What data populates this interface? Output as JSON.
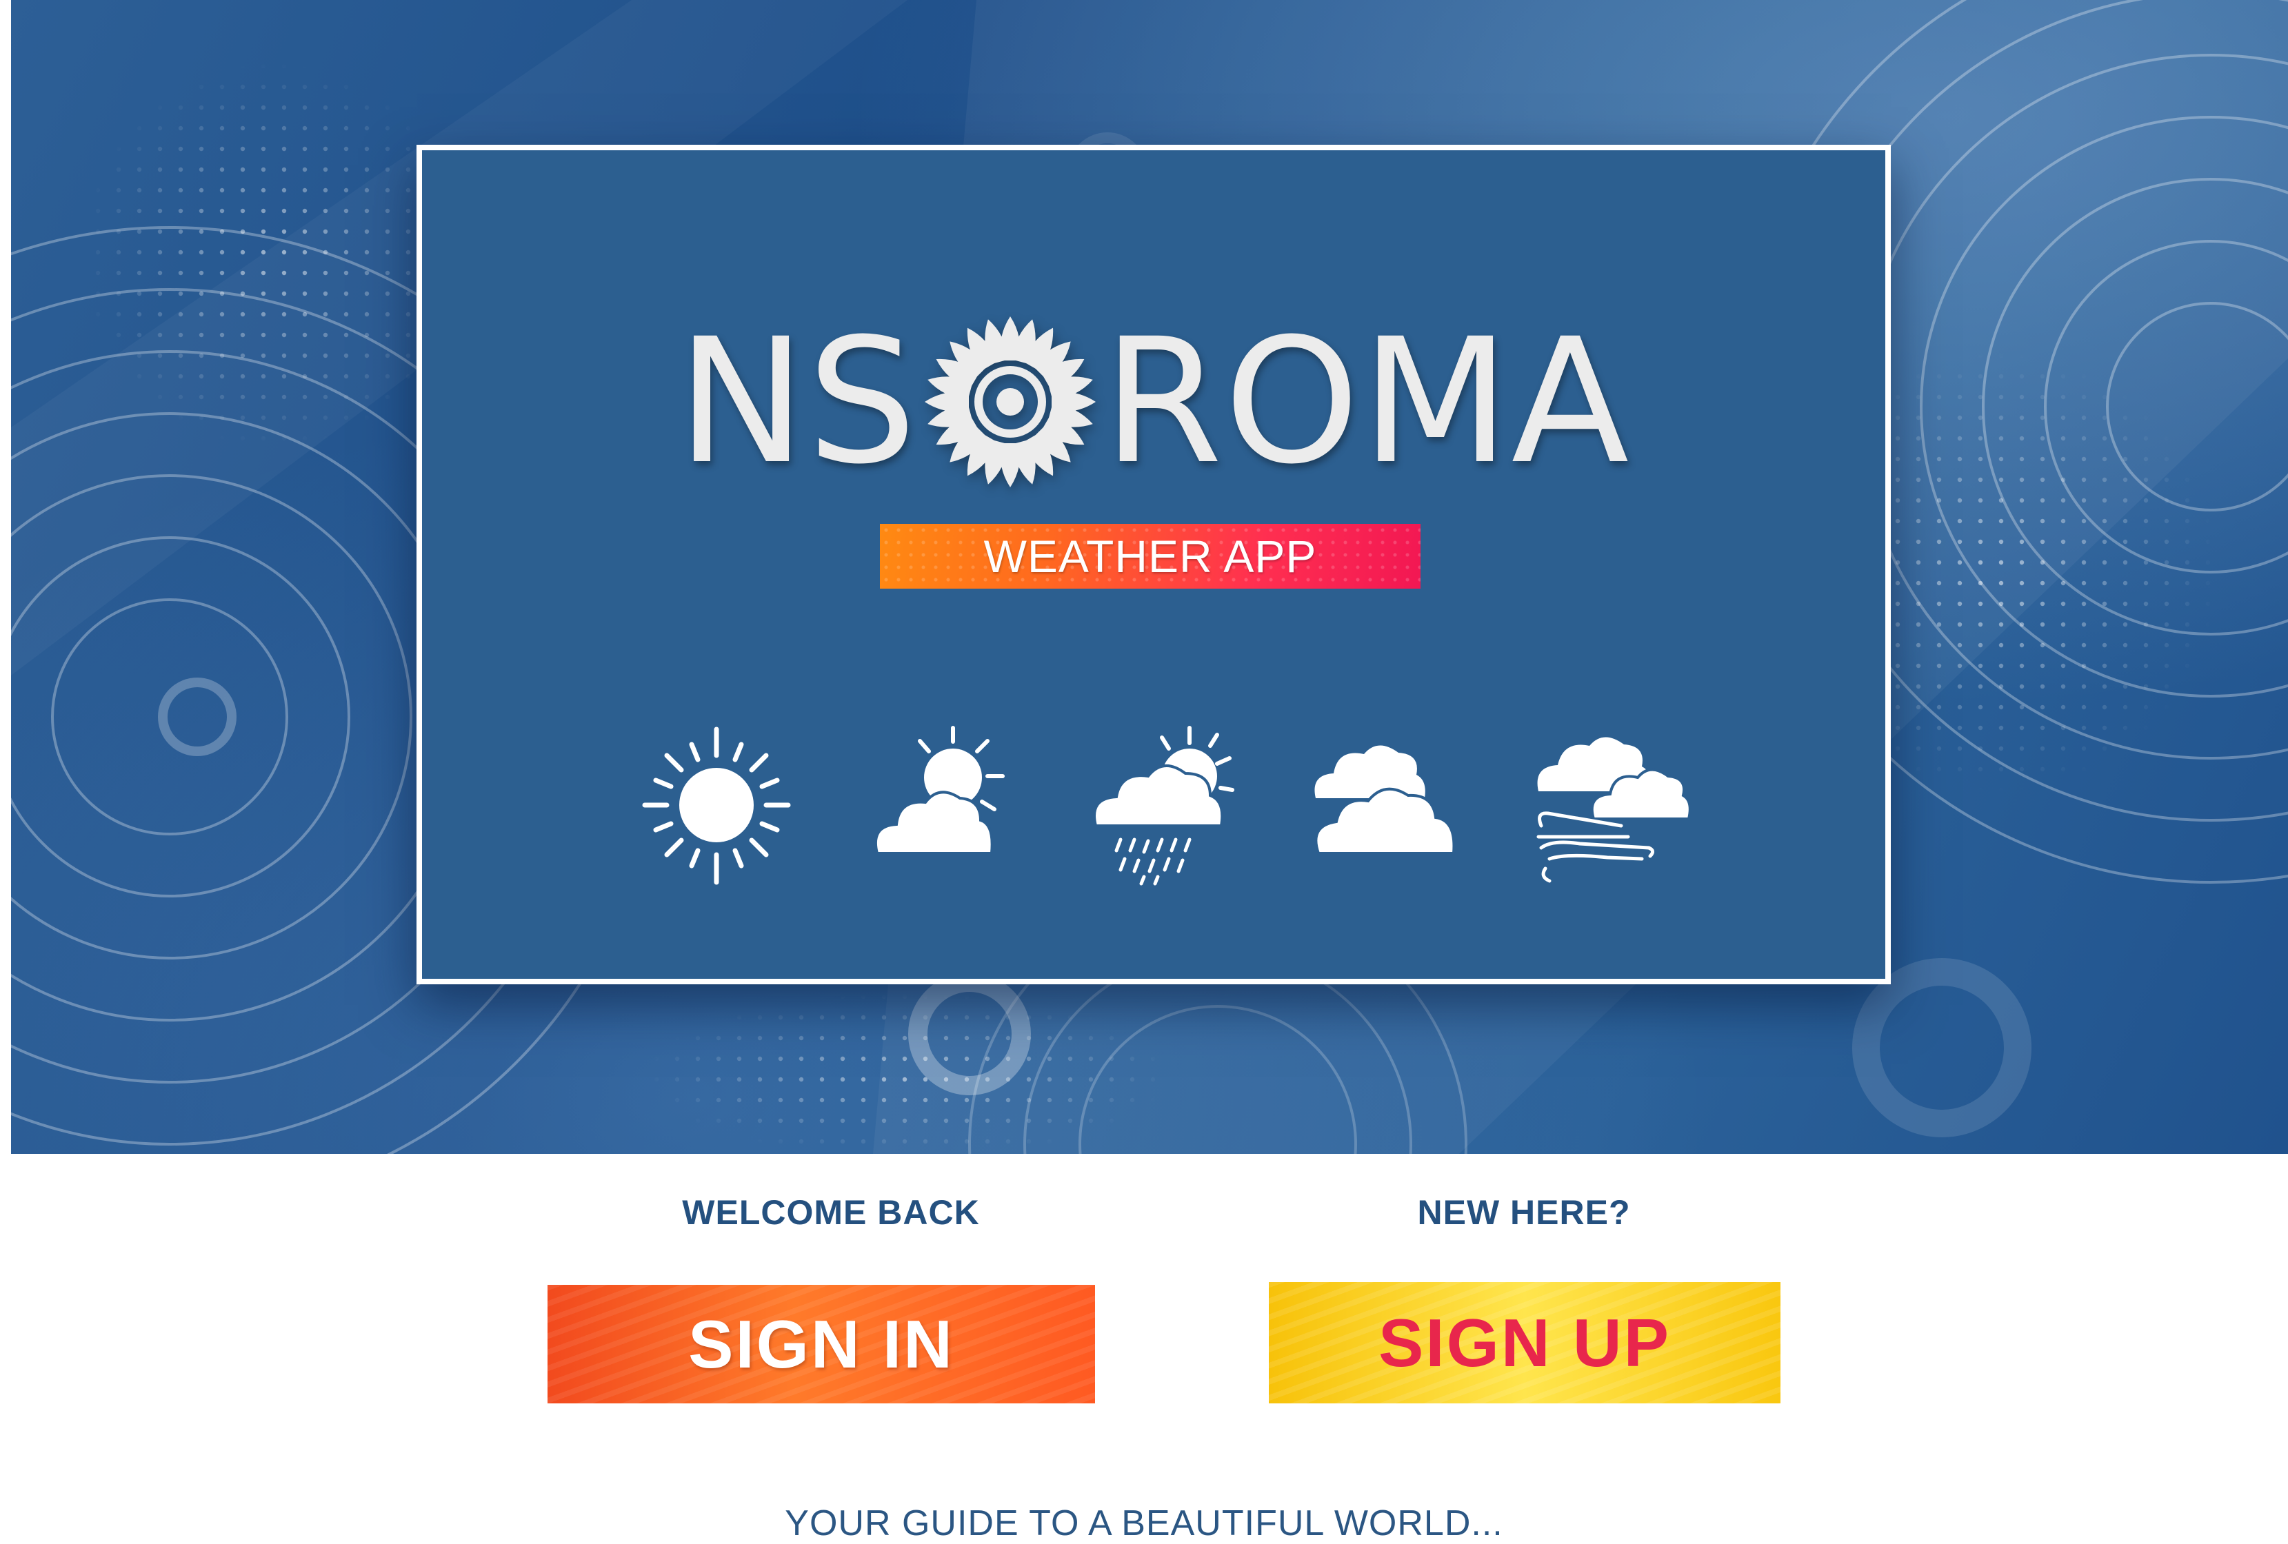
{
  "app": {
    "logo_left": "NS",
    "logo_right": "ROMA",
    "subtitle": "WEATHER APP"
  },
  "weather_icons": [
    "sun-icon",
    "partly-sunny-icon",
    "sun-rain-icon",
    "cloudy-icon",
    "windy-icon"
  ],
  "auth": {
    "welcome_label": "WELCOME BACK",
    "signin_label": "SIGN IN",
    "new_label": "NEW HERE?",
    "signup_label": "SIGN UP"
  },
  "tagline": "YOUR GUIDE TO A BEAUTIFUL WORLD...",
  "colors": {
    "hero_blue": "#2c5f90",
    "banner_orange": "#ff7a1a",
    "banner_pink": "#f21753",
    "signin_orange": "#ff5a22",
    "signup_yellow": "#ffd21f",
    "signup_text": "#e8264c",
    "text_blue": "#24507f"
  }
}
